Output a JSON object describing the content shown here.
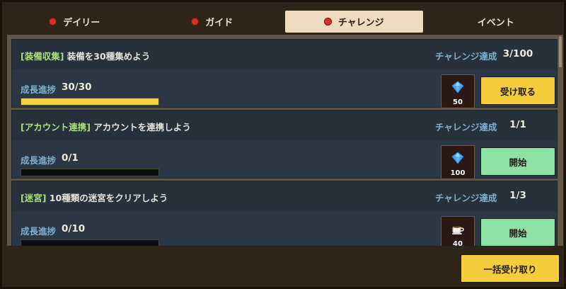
{
  "tabs": [
    {
      "label": "デイリー",
      "active": false
    },
    {
      "label": "ガイド",
      "active": false
    },
    {
      "label": "チャレンジ",
      "active": true
    },
    {
      "label": "イベント",
      "active": false
    }
  ],
  "challenges": [
    {
      "tag": "[装備収集]",
      "title": "装備を30種集めよう",
      "challenge_label": "チャレンジ達成",
      "challenge_count": "3/100",
      "progress_label": "成長進捗",
      "progress_value": "30/30",
      "progress_fraction": 1.0,
      "reward_icon": "diamond-icon",
      "reward_qty": "50",
      "button_label": "受け取る",
      "button_type": "claim"
    },
    {
      "tag": "[アカウント連携]",
      "title": "アカウントを連携しよう",
      "challenge_label": "チャレンジ達成",
      "challenge_count": "1/1",
      "progress_label": "成長進捗",
      "progress_value": "0/1",
      "progress_fraction": 0.0,
      "reward_icon": "diamond-icon",
      "reward_qty": "100",
      "button_label": "開始",
      "button_type": "start"
    },
    {
      "tag": "[迷宮]",
      "title": "10種類の迷宮をクリアしよう",
      "challenge_label": "チャレンジ達成",
      "challenge_count": "1/3",
      "progress_label": "成長進捗",
      "progress_value": "0/10",
      "progress_fraction": 0.0,
      "reward_icon": "coffee-cup-icon",
      "reward_qty": "40",
      "button_label": "開始",
      "button_type": "start"
    }
  ],
  "footer": {
    "claim_all_label": "一括受け取り"
  },
  "colors": {
    "tab_dot": "#d9302b",
    "claim_button": "#f5cc3b",
    "start_button": "#8ee1a4",
    "progress_fill": "#f4d63c",
    "tag_green": "#a9e07e",
    "label_blue": "#7fb0cf"
  }
}
